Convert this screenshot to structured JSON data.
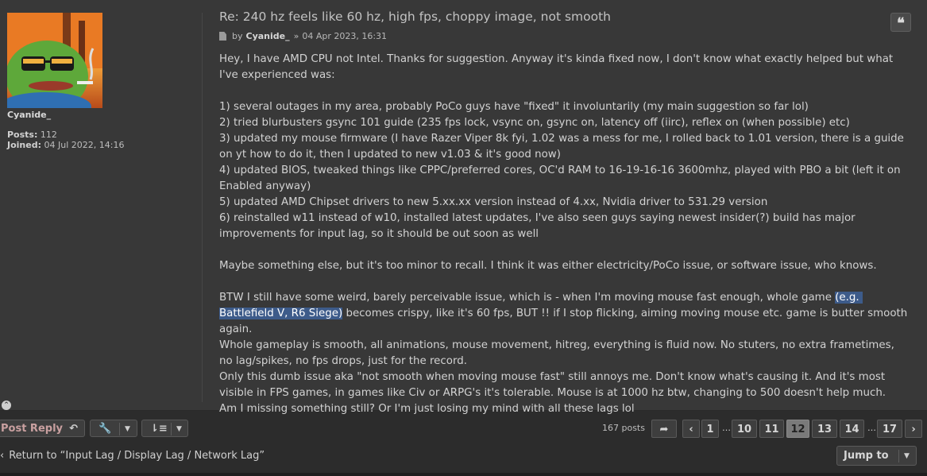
{
  "user": {
    "name": "Cyanide_",
    "posts_label": "Posts:",
    "posts_value": "112",
    "joined_label": "Joined:",
    "joined_value": "04 Jul 2022, 14:16"
  },
  "post": {
    "title": "Re: 240 hz feels like 60 hz, high fps, choppy image, not smooth",
    "by_label": "by",
    "author": "Cyanide_",
    "separator": "»",
    "date": "04 Apr 2023, 16:31",
    "quote_icon": "quote-icon",
    "content_before_highlight": "Hey, I have AMD CPU not Intel. Thanks for suggestion. Anyway it's kinda fixed now, I don't know what exactly helped but what I've experienced was:\n\n1) several outages in my area, probably PoCo guys have \"fixed\" it involuntarily (my main suggestion so far lol)\n2) tried blurbusters gsync 101 guide (235 fps lock, vsync on, gsync on, latency off (iirc), reflex on (when possible) etc)\n3) updated my mouse firmware (I have Razer Viper 8k fyi, 1.02 was a mess for me, I rolled back to 1.01 version, there is a guide on yt how to do it, then I updated to new v1.03 & it's good now)\n4) updated BIOS, tweaked things like CPPC/preferred cores, OC'd RAM to 16-19-16-16 3600mhz, played with PBO a bit (left it on Enabled anyway)\n5) updated AMD Chipset drivers to new 5.xx.xx version instead of 4.xx, Nvidia driver to 531.29 version\n6) reinstalled w11 instead of w10, installed latest updates, I've also seen guys saying newest insider(?) build has major improvements for input lag, so it should be out soon as well\n\nMaybe something else, but it's too minor to recall. I think it was either electricity/PoCo issue, or software issue, who knows.\n\nBTW I still have some weird, barely perceivable issue, which is - when I'm moving mouse fast enough, whole game ",
    "content_highlight": "(e.g. Battlefield V, R6 Siege)",
    "content_after_highlight": " becomes crispy, like it's 60 fps, BUT !! if I stop flicking, aiming moving mouse etc. game is butter smooth again.\nWhole gameplay is smooth, all animations, mouse movement, hitreg, everything is fluid now. No stuters, no extra frametimes, no lag/spikes, no fps drops, just for the record.\nOnly this dumb issue aka \"not smooth when moving mouse fast\" still annoys me. Don't know what's causing it. And it's most visible in FPS games, in games like Civ or ARPG's it's tolerable. Mouse is at 1000 hz btw, changing to 500 doesn't help much.\nAm I missing something still? Or I'm just losing my mind with all these lags lol"
  },
  "actions": {
    "post_reply": "Post Reply",
    "tools_icon": "wrench-icon",
    "sort_icon": "sort-icon"
  },
  "pagination": {
    "count": "167 posts",
    "pages": [
      "1",
      "10",
      "11",
      "12",
      "13",
      "14",
      "17"
    ],
    "ellipsis": "…",
    "current": "12"
  },
  "footer": {
    "return_text": "Return to “Input Lag / Display Lag / Network Lag”",
    "jump_to": "Jump to"
  },
  "colors": {
    "background": "#383838",
    "highlight": "#3d5b8a",
    "active_page": "#7a7a7a"
  }
}
